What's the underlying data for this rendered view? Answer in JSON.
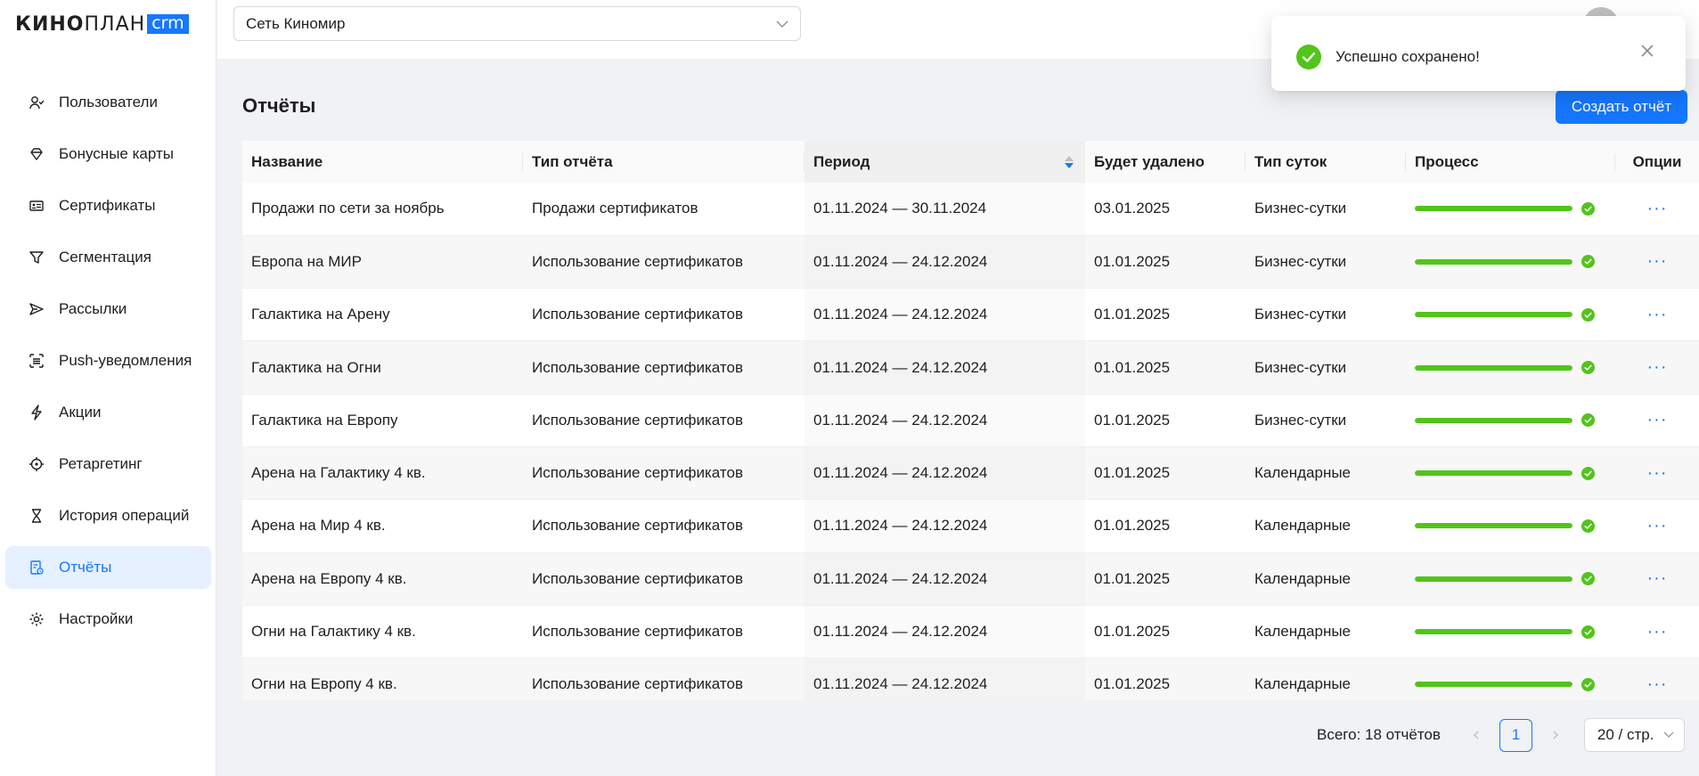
{
  "sidebar": {
    "logo": {
      "bold": "КИНО",
      "light": "ПЛАН",
      "badge": "crm"
    },
    "items": [
      {
        "label": "Пользователи",
        "icon": "users-icon",
        "active": false
      },
      {
        "label": "Бонусные карты",
        "icon": "diamond-icon",
        "active": false
      },
      {
        "label": "Сертификаты",
        "icon": "id-card-icon",
        "active": false
      },
      {
        "label": "Сегментация",
        "icon": "filter-icon",
        "active": false
      },
      {
        "label": "Рассылки",
        "icon": "send-icon",
        "active": false
      },
      {
        "label": "Push-уведомления",
        "icon": "push-icon",
        "active": false
      },
      {
        "label": "Акции",
        "icon": "thunderbolt-icon",
        "active": false
      },
      {
        "label": "Ретаргетинг",
        "icon": "aim-icon",
        "active": false
      },
      {
        "label": "История операций",
        "icon": "hourglass-icon",
        "active": false
      },
      {
        "label": "Отчёты",
        "icon": "report-icon",
        "active": true
      },
      {
        "label": "Настройки",
        "icon": "gear-icon",
        "active": false
      }
    ]
  },
  "header": {
    "network_select": "Сеть Киномир"
  },
  "page": {
    "title": "Отчёты",
    "create_button": "Создать отчёт"
  },
  "table": {
    "columns": [
      "Название",
      "Тип отчёта",
      "Период",
      "Будет удалено",
      "Тип суток",
      "Процесс",
      "Опции"
    ],
    "sorted_column": "Период",
    "rows": [
      {
        "name": "Продажи по сети за ноябрь",
        "type": "Продажи сертификатов",
        "period": "01.11.2024 — 30.11.2024",
        "delete": "03.01.2025",
        "day_type": "Бизнес-сутки",
        "progress": 100
      },
      {
        "name": "Европа на МИР",
        "type": "Использование сертификатов",
        "period": "01.11.2024 — 24.12.2024",
        "delete": "01.01.2025",
        "day_type": "Бизнес-сутки",
        "progress": 100
      },
      {
        "name": "Галактика на Арену",
        "type": "Использование сертификатов",
        "period": "01.11.2024 — 24.12.2024",
        "delete": "01.01.2025",
        "day_type": "Бизнес-сутки",
        "progress": 100
      },
      {
        "name": "Галактика на Огни",
        "type": "Использование сертификатов",
        "period": "01.11.2024 — 24.12.2024",
        "delete": "01.01.2025",
        "day_type": "Бизнес-сутки",
        "progress": 100
      },
      {
        "name": "Галактика на Европу",
        "type": "Использование сертификатов",
        "period": "01.11.2024 — 24.12.2024",
        "delete": "01.01.2025",
        "day_type": "Бизнес-сутки",
        "progress": 100
      },
      {
        "name": "Арена на Галактику 4 кв.",
        "type": "Использование сертификатов",
        "period": "01.11.2024 — 24.12.2024",
        "delete": "01.01.2025",
        "day_type": "Календарные",
        "progress": 100
      },
      {
        "name": "Арена на Мир 4 кв.",
        "type": "Использование сертификатов",
        "period": "01.11.2024 — 24.12.2024",
        "delete": "01.01.2025",
        "day_type": "Календарные",
        "progress": 100
      },
      {
        "name": "Арена на Европу 4 кв.",
        "type": "Использование сертификатов",
        "period": "01.11.2024 — 24.12.2024",
        "delete": "01.01.2025",
        "day_type": "Календарные",
        "progress": 100
      },
      {
        "name": "Огни на Галактику 4 кв.",
        "type": "Использование сертификатов",
        "period": "01.11.2024 — 24.12.2024",
        "delete": "01.01.2025",
        "day_type": "Календарные",
        "progress": 100
      },
      {
        "name": "Огни на Европу 4 кв.",
        "type": "Использование сертификатов",
        "period": "01.11.2024 — 24.12.2024",
        "delete": "01.01.2025",
        "day_type": "Календарные",
        "progress": 100
      }
    ],
    "options_glyph": "···"
  },
  "pagination": {
    "total_label": "Всего: 18 отчётов",
    "current_page": "1",
    "page_size": "20 / стр."
  },
  "toast": {
    "message": "Успешно сохранено!",
    "icon": "check-circle-icon"
  },
  "colors": {
    "accent": "#1677ff",
    "success": "#52c41a",
    "active_bg": "#e6f0ff"
  }
}
